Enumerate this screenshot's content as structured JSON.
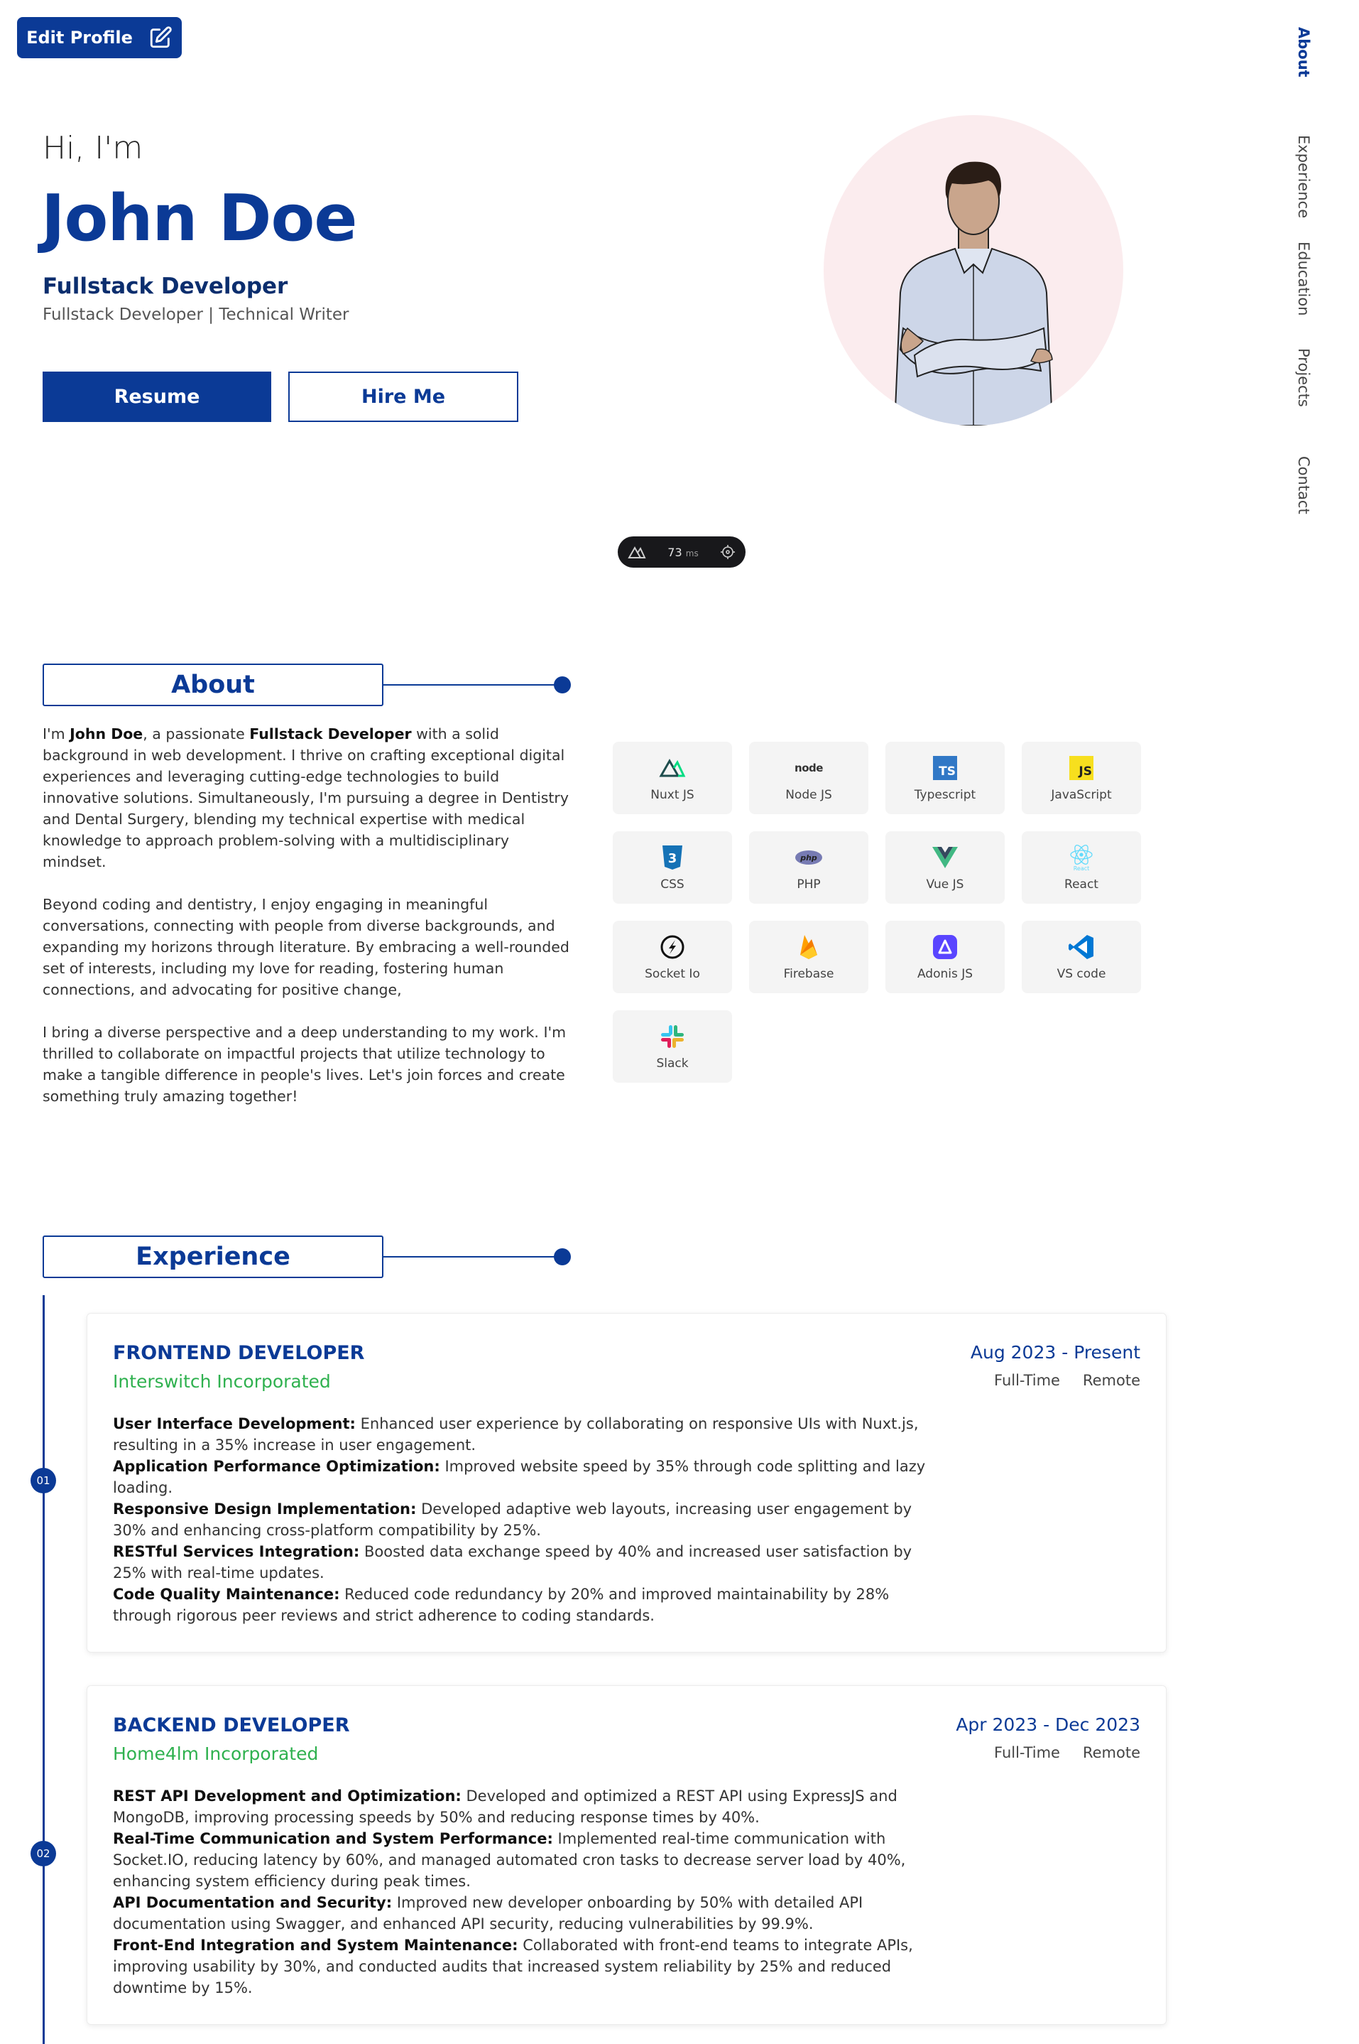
{
  "header": {
    "edit_profile": "Edit Profile"
  },
  "nav": [
    {
      "label": "About",
      "active": true
    },
    {
      "label": "Experience",
      "active": false
    },
    {
      "label": "Education",
      "active": false
    },
    {
      "label": "Projects",
      "active": false
    },
    {
      "label": "Contact",
      "active": false
    }
  ],
  "hero": {
    "greeting": "Hi, I'm",
    "name": "John Doe",
    "role": "Fullstack Developer",
    "subtitle": "Fullstack Developer | Technical Writer",
    "resume_label": "Resume",
    "hire_label": "Hire Me"
  },
  "devtools": {
    "ms_value": "73",
    "ms_unit": "ms"
  },
  "about": {
    "heading": "About",
    "p1_a": "I'm ",
    "p1_name": "John Doe",
    "p1_b": ", a passionate ",
    "p1_role": "Fullstack Developer",
    "p1_c": " with a solid background in web development. I thrive on crafting exceptional digital experiences and leveraging cutting-edge technologies to build innovative solutions. Simultaneously, I'm pursuing a degree in Dentistry and Dental Surgery, blending my technical expertise with medical knowledge to approach problem-solving with a multidisciplinary mindset.",
    "p2": "Beyond coding and dentistry, I enjoy engaging in meaningful conversations, connecting with people from diverse backgrounds, and expanding my horizons through literature. By embracing a well-rounded set of interests, including my love for reading, fostering human connections, and advocating for positive change,",
    "p3": "I bring a diverse perspective and a deep understanding to my work. I'm thrilled to collaborate on impactful projects that utilize technology to make a tangible difference in people's lives. Let's join forces and create something truly amazing together!"
  },
  "skills": [
    {
      "label": "Nuxt JS",
      "icon": "nuxt-icon"
    },
    {
      "label": "Node JS",
      "icon": "node-icon"
    },
    {
      "label": "Typescript",
      "icon": "typescript-icon"
    },
    {
      "label": "JavaScript",
      "icon": "javascript-icon"
    },
    {
      "label": "CSS",
      "icon": "css-icon"
    },
    {
      "label": "PHP",
      "icon": "php-icon"
    },
    {
      "label": "Vue JS",
      "icon": "vue-icon"
    },
    {
      "label": "React",
      "icon": "react-icon"
    },
    {
      "label": "Socket Io",
      "icon": "socketio-icon"
    },
    {
      "label": "Firebase",
      "icon": "firebase-icon"
    },
    {
      "label": "Adonis JS",
      "icon": "adonis-icon"
    },
    {
      "label": "VS code",
      "icon": "vscode-icon"
    },
    {
      "label": "Slack",
      "icon": "slack-icon"
    }
  ],
  "skill_icon_text": {
    "node": "node",
    "ts": "TS",
    "js": "JS",
    "php": "php",
    "css": "3",
    "react": "React"
  },
  "experience": {
    "heading": "Experience",
    "items": [
      {
        "index": "01",
        "title": "FRONTEND DEVELOPER",
        "company": "Interswitch Incorporated",
        "date": "Aug 2023 - Present",
        "type": "Full-Time",
        "mode": "Remote",
        "points": [
          {
            "label": "User Interface Development:",
            "text": " Enhanced user experience by collaborating on responsive UIs with Nuxt.js, resulting in a 35% increase in user engagement."
          },
          {
            "label": "Application Performance Optimization:",
            "text": " Improved website speed by 35% through code splitting and lazy loading."
          },
          {
            "label": "Responsive Design Implementation:",
            "text": " Developed adaptive web layouts, increasing user engagement by 30% and enhancing cross-platform compatibility by 25%."
          },
          {
            "label": "RESTful Services Integration:",
            "text": " Boosted data exchange speed by 40% and increased user satisfaction by 25% with real-time updates."
          },
          {
            "label": "Code Quality Maintenance:",
            "text": " Reduced code redundancy by 20% and improved maintainability by 28% through rigorous peer reviews and strict adherence to coding standards."
          }
        ]
      },
      {
        "index": "02",
        "title": "BACKEND DEVELOPER",
        "company": "Home4lm Incorporated",
        "date": "Apr 2023 - Dec 2023",
        "type": "Full-Time",
        "mode": "Remote",
        "points": [
          {
            "label": "REST API Development and Optimization:",
            "text": " Developed and optimized a REST API using ExpressJS and MongoDB, improving processing speeds by 50% and reducing response times by 40%."
          },
          {
            "label": "Real-Time Communication and System Performance:",
            "text": " Implemented real-time communication with Socket.IO, reducing latency by 60%, and managed automated cron tasks to decrease server load by 40%, enhancing system efficiency during peak times."
          },
          {
            "label": "API Documentation and Security:",
            "text": " Improved new developer onboarding by 50% with detailed API documentation using Swagger, and enhanced API security, reducing vulnerabilities by 99.9%."
          },
          {
            "label": "Front-End Integration and System Maintenance:",
            "text": " Collaborated with front-end teams to integrate APIs, improving usability by 30%, and conducted audits that increased system reliability by 25% and reduced downtime by 15%."
          }
        ]
      }
    ]
  },
  "colors": {
    "primary": "#0b3a96",
    "company_green": "#2fb14f",
    "avatar_bg": "#fbecee",
    "card_bg": "#f4f4f4"
  }
}
